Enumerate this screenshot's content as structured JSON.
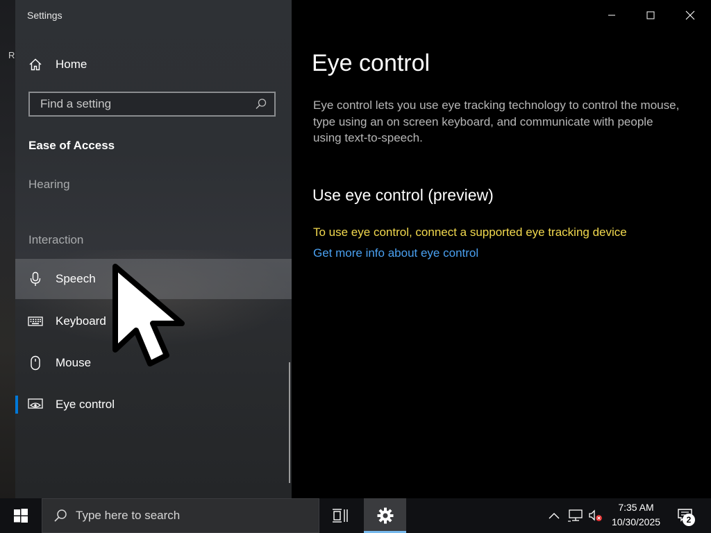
{
  "window": {
    "title": "Settings"
  },
  "desktop": {
    "edge_text": "R"
  },
  "nav": {
    "home_label": "Home",
    "search_placeholder": "Find a setting",
    "section_title": "Ease of Access",
    "groups": [
      "Hearing",
      "Interaction"
    ],
    "items": [
      {
        "label": "Speech",
        "icon": "microphone-icon",
        "state": "hover"
      },
      {
        "label": "Keyboard",
        "icon": "keyboard-icon"
      },
      {
        "label": "Mouse",
        "icon": "mouse-icon"
      },
      {
        "label": "Eye control",
        "icon": "eye-icon",
        "state": "selected"
      }
    ],
    "accent_color": "#0078d7"
  },
  "content": {
    "title": "Eye control",
    "description": "Eye control lets you use eye tracking technology to control the mouse, type using an on screen keyboard, and communicate with people using text-to-speech.",
    "subtitle": "Use eye control (preview)",
    "warning": "To use eye control, connect a supported eye tracking device",
    "link": "Get more info about eye control",
    "warning_color": "#f2d94e",
    "link_color": "#4aa0f0"
  },
  "taskbar": {
    "search_placeholder": "Type here to search",
    "time": "7:35 AM",
    "date": "10/30/2025",
    "notification_count": "2"
  }
}
